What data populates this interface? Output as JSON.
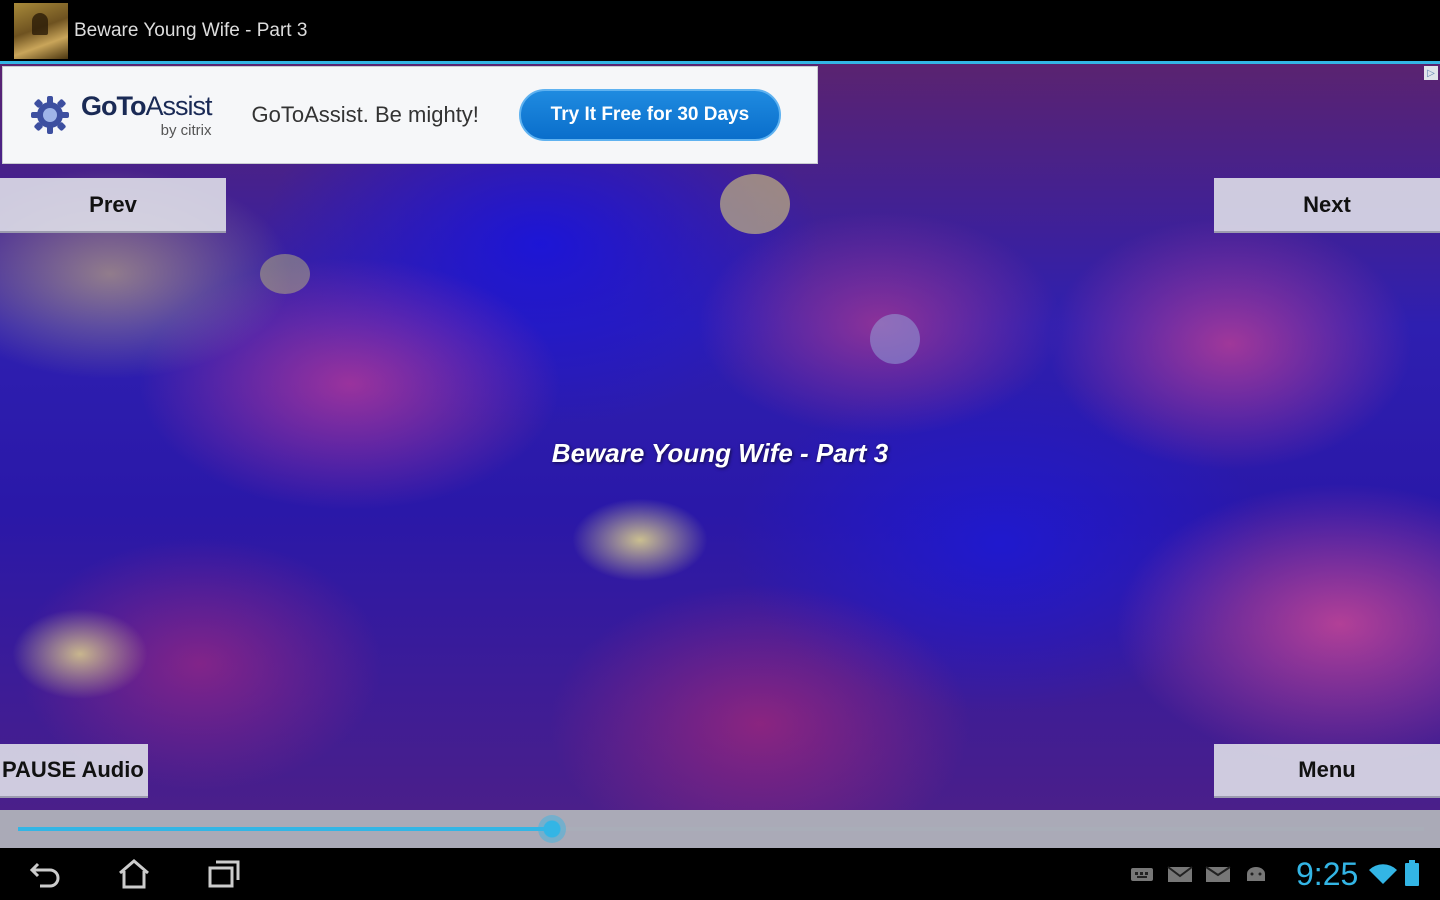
{
  "window": {
    "title": "Beware Young Wife - Part 3"
  },
  "ad": {
    "brand_go_to": "GoTo",
    "brand_assist": "Assist",
    "brand_sub": "by citrix",
    "tagline": "GoToAssist. Be mighty!",
    "cta_label": "Try It Free for 30 Days"
  },
  "buttons": {
    "prev": "Prev",
    "next": "Next",
    "pause": "PAUSE Audio",
    "menu": "Menu"
  },
  "content": {
    "title": "Beware Young Wife - Part 3"
  },
  "playback": {
    "progress": 0.38
  },
  "status_bar": {
    "time": "9:25"
  },
  "colors": {
    "accent": "#33b5e5",
    "ad_cta": "#1f8be0"
  },
  "icons": {
    "nav": [
      "back-icon",
      "home-icon",
      "recent-apps-icon"
    ],
    "status": [
      "keyboard-icon",
      "gmail-icon",
      "email-icon",
      "android-icon",
      "wifi-icon",
      "battery-icon"
    ]
  }
}
